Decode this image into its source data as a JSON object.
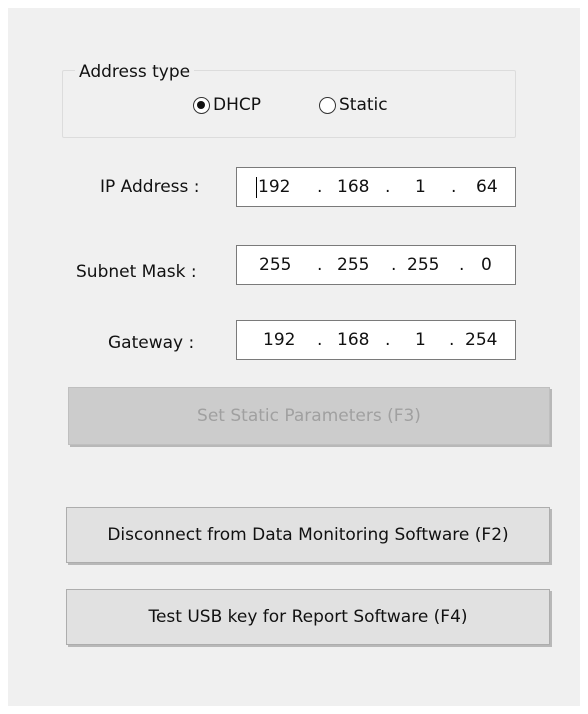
{
  "address_type": {
    "title": "Address type",
    "options": [
      {
        "label": "DHCP",
        "selected": true
      },
      {
        "label": "Static",
        "selected": false
      }
    ]
  },
  "ip_address": {
    "label": "IP Address :",
    "octets": [
      "192",
      "168",
      "1",
      "64"
    ]
  },
  "subnet_mask": {
    "label": "Subnet Mask :",
    "octets": [
      "255",
      "255",
      "255",
      "0"
    ]
  },
  "gateway": {
    "label": "Gateway :",
    "octets": [
      "192",
      "168",
      "1",
      "254"
    ]
  },
  "buttons": {
    "set_static": {
      "label": "Set Static Parameters (F3)",
      "enabled": false
    },
    "disconnect": {
      "label": "Disconnect from Data Monitoring Software (F2)",
      "enabled": true
    },
    "test_usb": {
      "label": "Test USB key for Report Software (F4)",
      "enabled": true
    }
  },
  "ip_separator": "."
}
